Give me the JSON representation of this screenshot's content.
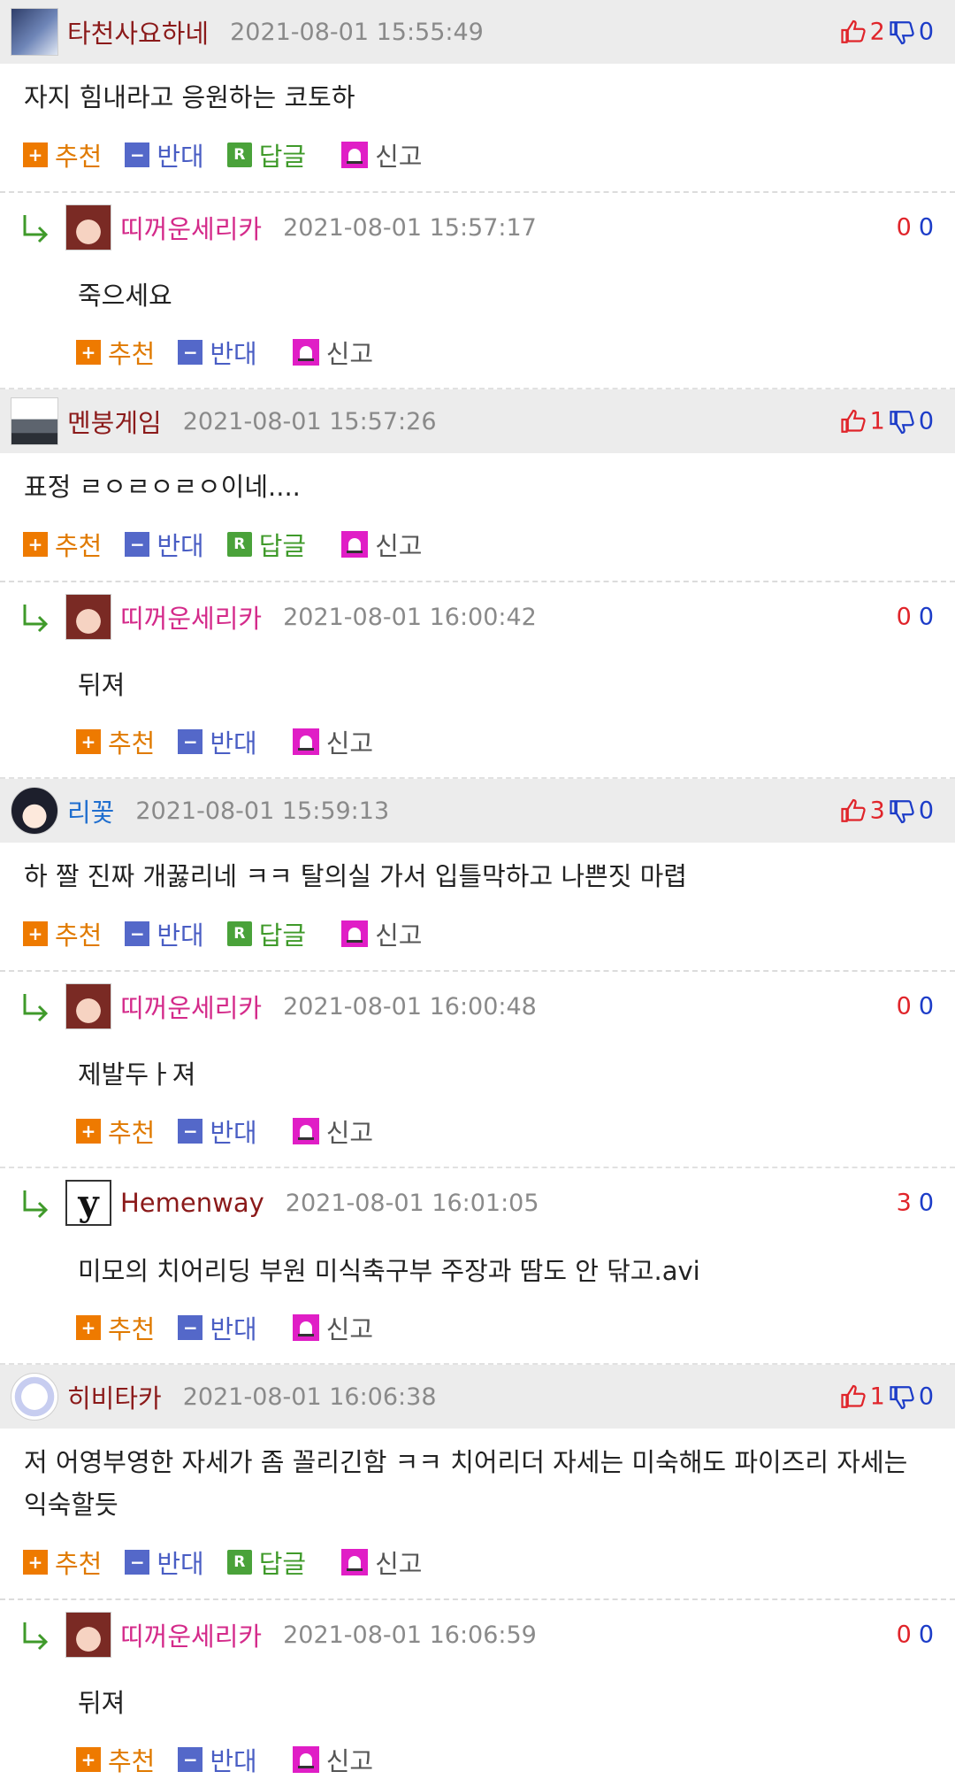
{
  "labels": {
    "recommend": "추천",
    "oppose": "반대",
    "reply": "답글",
    "report": "신고",
    "reply_glyph": "R",
    "plus_glyph": "+",
    "minus_glyph": "−"
  },
  "colors": {
    "header_bg": "#ececec",
    "nick_dark_red": "#8b1a1a",
    "reply_nick_pink": "#d42a8a",
    "up_red": "#e0242a",
    "down_blue": "#1c3cc8"
  },
  "comments": [
    {
      "nick": "타천사요하네",
      "date": "2021-08-01 15:55:49",
      "up": "2",
      "down": "0",
      "text": "자지 힘내라고 응원하는 코토하",
      "avatar_icon": "anime-avatar-icon",
      "replies": [
        {
          "nick": "띠꺼운세리카",
          "date": "2021-08-01 15:57:17",
          "up": "0",
          "down": "0",
          "text": "죽으세요"
        }
      ]
    },
    {
      "nick": "멘붕게임",
      "date": "2021-08-01 15:57:26",
      "up": "1",
      "down": "0",
      "text": "표정 ㄹㅇㄹㅇㄹㅇ이네....",
      "avatar_icon": "landscape-avatar-icon",
      "replies": [
        {
          "nick": "띠꺼운세리카",
          "date": "2021-08-01 16:00:42",
          "up": "0",
          "down": "0",
          "text": "뒤져"
        }
      ]
    },
    {
      "nick": "리꽃",
      "date": "2021-08-01 15:59:13",
      "up": "3",
      "down": "0",
      "text": "하 짤 진짜 개꿇리네 ㅋㅋ 탈의실 가서 입틀막하고 나쁜짓 마렵",
      "avatar_icon": "anime-girl-avatar-icon",
      "replies": [
        {
          "nick": "띠꺼운세리카",
          "date": "2021-08-01 16:00:48",
          "up": "0",
          "down": "0",
          "text": "제발두ㅏ져"
        },
        {
          "nick": "Hemenway",
          "date": "2021-08-01 16:01:05",
          "up": "3",
          "down": "0",
          "text": "미모의 치어리딩 부원 미식축구부 주장과 땀도 안 닦고.avi"
        }
      ]
    },
    {
      "nick": "히비타카",
      "date": "2021-08-01 16:06:38",
      "up": "1",
      "down": "0",
      "text": "저 어영부영한 자세가 좀 꼴리긴함 ㅋㅋ 치어리더 자세는 미숙해도 파이즈리 자세는 익숙할듯",
      "avatar_icon": "sketch-avatar-icon",
      "replies": [
        {
          "nick": "띠꺼운세리카",
          "date": "2021-08-01 16:06:59",
          "up": "0",
          "down": "0",
          "text": "뒤져"
        }
      ]
    }
  ]
}
